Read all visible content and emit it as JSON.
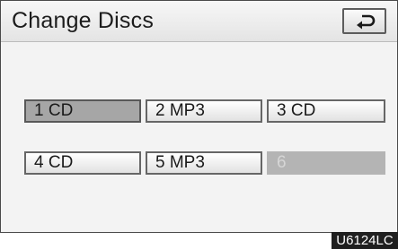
{
  "header": {
    "title": "Change Discs",
    "back_icon": "return-arrow-icon"
  },
  "discs": [
    {
      "label": "1 CD",
      "state": "selected"
    },
    {
      "label": "2 MP3",
      "state": "normal"
    },
    {
      "label": "3 CD",
      "state": "normal"
    },
    {
      "label": "4 CD",
      "state": "normal"
    },
    {
      "label": "5 MP3",
      "state": "normal"
    },
    {
      "label": "6",
      "state": "disabled"
    }
  ],
  "figure_code": "U6124LC",
  "colors": {
    "selected": "#a6a6a6",
    "disabled": "#b4b4b4",
    "border": "#666666",
    "code_bg": "#1f1f1f"
  }
}
